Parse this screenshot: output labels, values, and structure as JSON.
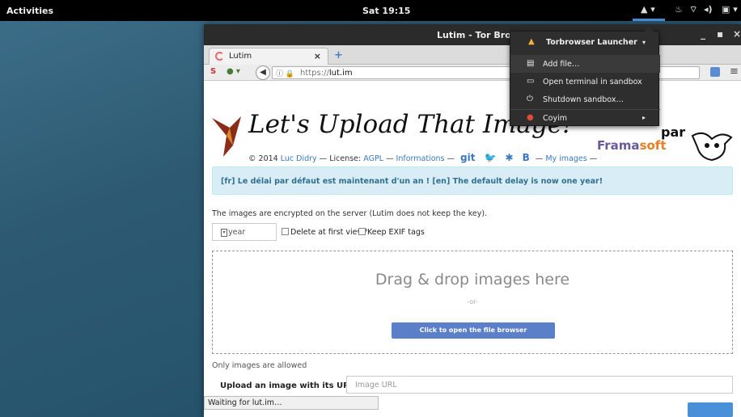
{
  "topbar": {
    "activities": "Activities",
    "clock": "Sat 19:15"
  },
  "window": {
    "title": "Lutim - Tor Browser"
  },
  "tab": {
    "label": "Lutim",
    "close": "×",
    "new_tab": "+"
  },
  "navbar": {
    "url_prefix": "https://",
    "url_domain": "lut.im"
  },
  "page": {
    "title": "Let's Upload That Image!",
    "credits": {
      "copyright": "© 2014",
      "author": "Luc Didry",
      "license_label": "— License:",
      "license": "AGPL",
      "informations": "Informations",
      "dash": "—",
      "git": "git",
      "bitcoin": "B",
      "my_images": "My images"
    },
    "par": "par",
    "framasoft_a": "Frama",
    "framasoft_b": "soft",
    "alert": "[fr] Le délai par défaut est maintenant d'un an ! [en] The default delay is now one year!",
    "encrypted_note": "The images are encrypted on the server (Lutim does not keep the key).",
    "delay_select": "1 year",
    "delete_first_view": "Delete at first view?",
    "keep_exif": "Keep EXIF tags",
    "drop_title": "Drag & drop images here",
    "drop_or": "-or-",
    "file_browser_button": "Click to open the file browser",
    "only_images": "Only images are allowed",
    "upload_url_label": "Upload an image with its URL",
    "image_url_placeholder": "Image URL"
  },
  "statusbar": "Waiting for lut.im…",
  "dropdown": {
    "header": "Torbrowser Launcher",
    "items": [
      {
        "label": "Add file…",
        "icon": "document-icon"
      },
      {
        "label": "Open terminal in sandbox",
        "icon": "terminal-icon"
      },
      {
        "label": "Shutdown sandbox…",
        "icon": "power-icon"
      },
      {
        "label": "Coyim",
        "icon": "coyim-icon"
      }
    ]
  },
  "colors": {
    "dropdown_bg": "#2e2e2e",
    "alert_bg": "#d9edf7",
    "button_blue": "#5b7fc9",
    "link": "#3b78c3"
  }
}
